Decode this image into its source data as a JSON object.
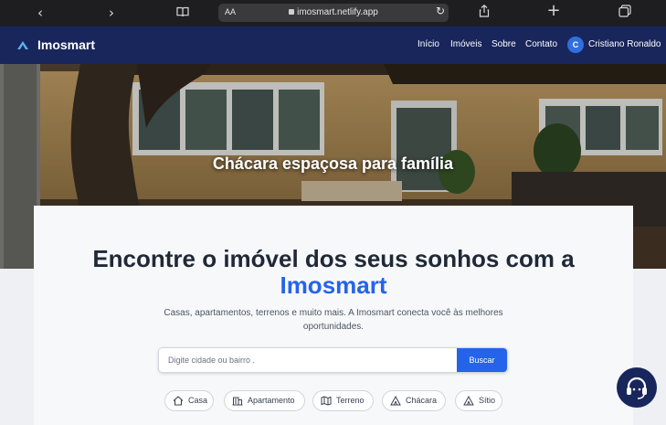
{
  "browser": {
    "url": "imosmart.netlify.app",
    "reader_label": "AA",
    "icons": [
      "chevron-left-icon",
      "chevron-right-icon",
      "book-icon",
      "lock-icon",
      "reload-icon",
      "share-icon",
      "plus-icon",
      "tabs-icon"
    ]
  },
  "navbar": {
    "brand": "Imosmart",
    "links": [
      "Início",
      "Imóveis",
      "Sobre",
      "Contato"
    ],
    "user_initial": "C",
    "user_name": "Cristiano Ronaldo",
    "bg_color": "#19265c",
    "avatar_color": "#2f6fe0"
  },
  "hero": {
    "caption": "Chácara espaçosa para família"
  },
  "main": {
    "headline": "Encontre o imóvel dos seus sonhos com a",
    "headline_brand": "Imosmart",
    "subtitle": "Casas, apartamentos, terrenos e muito mais. A Imosmart conecta você às melhores oportunidades.",
    "accent_color": "#2563eb",
    "search": {
      "placeholder": "Digite cidade ou bairro .",
      "button_label": "Buscar"
    },
    "categories": [
      {
        "label": "Casa",
        "icon": "home-icon"
      },
      {
        "label": "Apartamento",
        "icon": "building-icon"
      },
      {
        "label": "Terreno",
        "icon": "map-icon"
      },
      {
        "label": "Chácara",
        "icon": "tent-icon"
      },
      {
        "label": "Sítio",
        "icon": "tent-icon"
      }
    ]
  },
  "fab": {
    "icon": "support-agent-icon"
  }
}
